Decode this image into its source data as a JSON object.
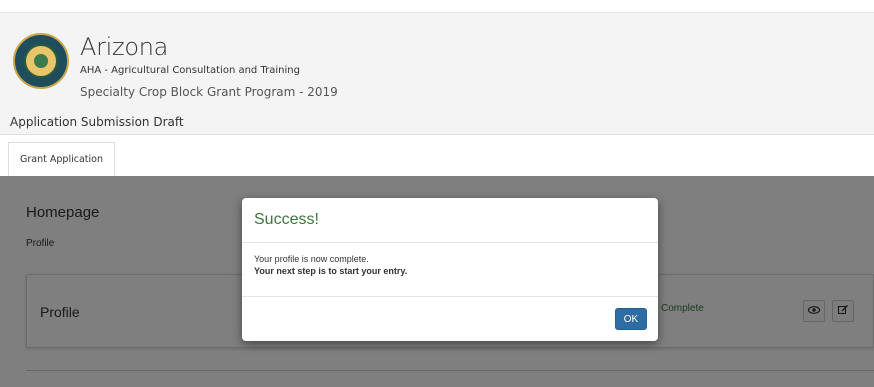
{
  "header": {
    "state_title": "Arizona",
    "org_name": "AHA - Agricultural Consultation and Training",
    "program_name": "Specialty Crop Block Grant Program - 2019",
    "seal_icon": "state-seal-icon"
  },
  "subbar": {
    "label": "Application Submission Draft"
  },
  "tabs": [
    {
      "label": "Grant Application",
      "active": true
    }
  ],
  "page": {
    "heading": "Homepage",
    "sublabel": "Profile",
    "profile_card": {
      "title": "Profile",
      "status": "Complete",
      "view_icon": "eye-icon",
      "edit_icon": "edit-icon"
    }
  },
  "modal": {
    "title": "Success!",
    "message": "Your profile is now complete.",
    "next_step": "Your next step is to start your entry.",
    "ok_label": "OK"
  },
  "colors": {
    "success_green": "#3c763d",
    "primary_blue": "#2e6da4",
    "backdrop": "rgba(0,0,0,0.5)"
  }
}
